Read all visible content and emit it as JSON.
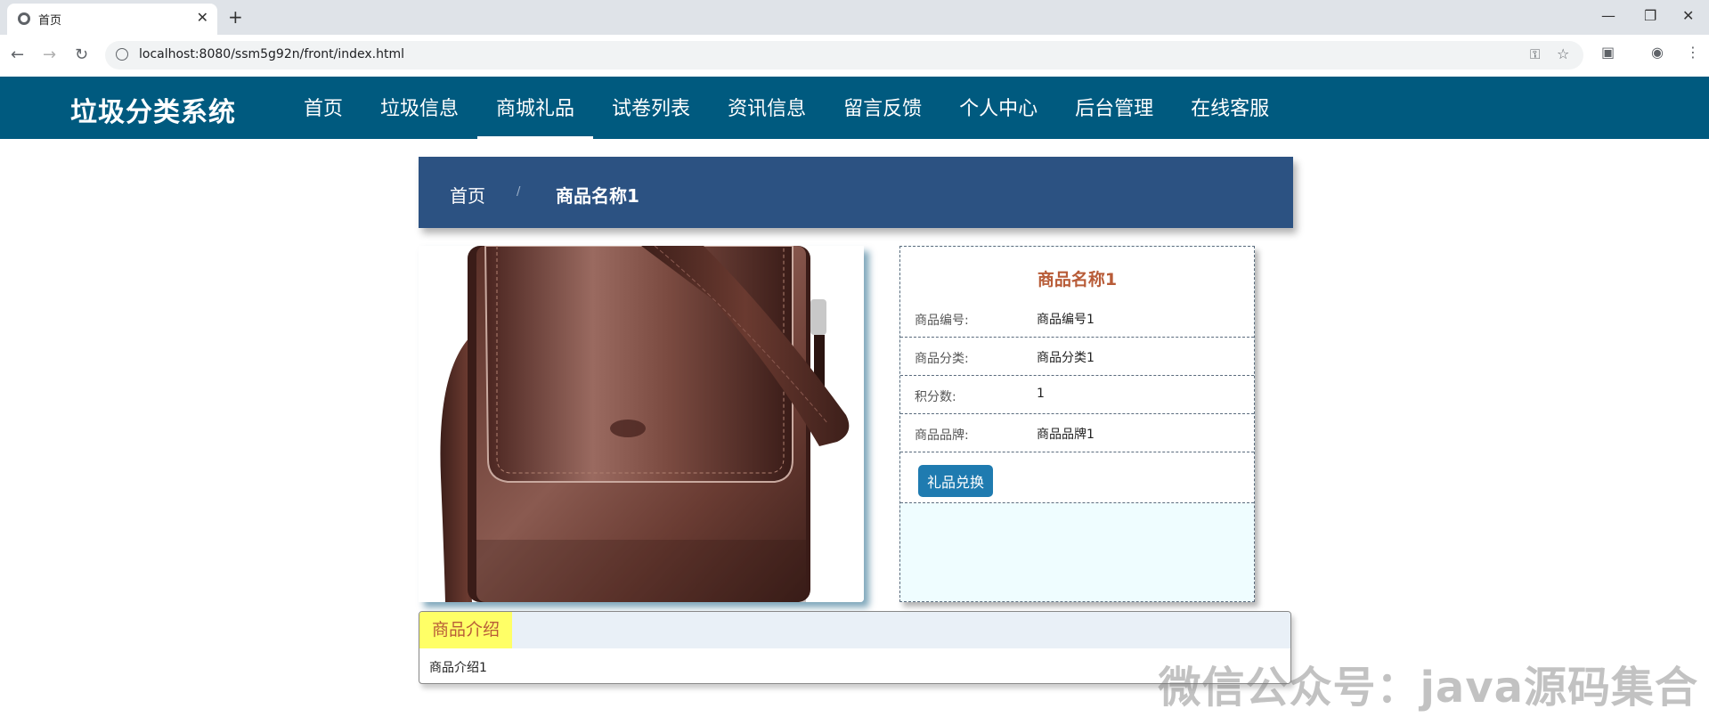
{
  "browser": {
    "tab_title": "首页",
    "tab_close": "✕",
    "new_tab": "+",
    "url": "localhost:8080/ssm5g92n/front/index.html",
    "win_minimize": "—",
    "win_restore": "❐",
    "win_close": "✕"
  },
  "site": {
    "logo": "垃圾分类系统",
    "menu": [
      "首页",
      "垃圾信息",
      "商城礼品",
      "试卷列表",
      "资讯信息",
      "留言反馈",
      "个人中心",
      "后台管理",
      "在线客服"
    ],
    "active_menu": "商城礼品"
  },
  "breadcrumb": {
    "home": "首页",
    "separator": "/",
    "current": "商品名称1"
  },
  "product": {
    "image_icon": "leather-bag-image",
    "title": "商品名称1",
    "fields": [
      {
        "label": "商品编号:",
        "value": "商品编号1"
      },
      {
        "label": "商品分类:",
        "value": "商品分类1"
      },
      {
        "label": "积分数:",
        "value": "1"
      },
      {
        "label": "商品品牌:",
        "value": "商品品牌1"
      }
    ],
    "redeem_label": "礼品兑换"
  },
  "intro": {
    "heading": "商品介绍",
    "text": "商品介绍1"
  },
  "watermark": "微信公众号：java源码集合",
  "colors": {
    "nav_bg": "#005a7f",
    "crumb_bg": "#2c5282",
    "button": "#1f7bb0",
    "accent_text": "#b85c38"
  }
}
